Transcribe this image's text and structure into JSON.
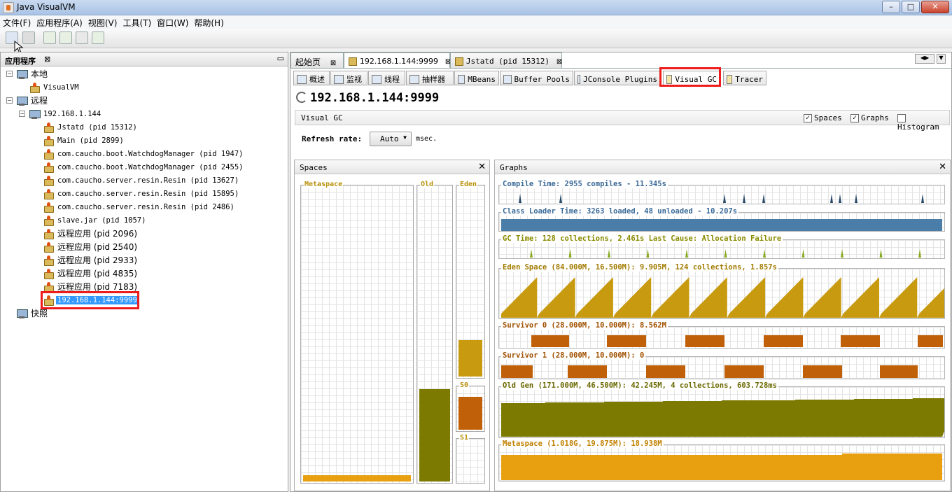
{
  "window": {
    "title": "Java VisualVM",
    "min": "–",
    "max": "□",
    "close": "✕"
  },
  "menu": [
    "文件(F)",
    "应用程序(A)",
    "视图(V)",
    "工具(T)",
    "窗口(W)",
    "帮助(H)"
  ],
  "left": {
    "title": "应用程序",
    "close": "⊠",
    "minimize": "▭",
    "tree": [
      {
        "label": "本地",
        "depth": 0,
        "icon": "computer-icon",
        "cn": true
      },
      {
        "label": "VisualVM",
        "depth": 1,
        "icon": "visualvm-icon"
      },
      {
        "label": "远程",
        "depth": 0,
        "icon": "remote-icon",
        "cn": true
      },
      {
        "label": "192.168.1.144",
        "depth": 1,
        "icon": "host-icon"
      },
      {
        "label": "Jstatd (pid 15312)",
        "depth": 2,
        "icon": "java-app-icon"
      },
      {
        "label": "Main (pid 2899)",
        "depth": 2,
        "icon": "java-app-icon"
      },
      {
        "label": "com.caucho.boot.WatchdogManager (pid 1947)",
        "depth": 2,
        "icon": "java-app-icon"
      },
      {
        "label": "com.caucho.boot.WatchdogManager (pid 2455)",
        "depth": 2,
        "icon": "java-app-icon"
      },
      {
        "label": "com.caucho.server.resin.Resin (pid 13627)",
        "depth": 2,
        "icon": "java-app-icon"
      },
      {
        "label": "com.caucho.server.resin.Resin (pid 15895)",
        "depth": 2,
        "icon": "java-app-icon"
      },
      {
        "label": "com.caucho.server.resin.Resin (pid 2486)",
        "depth": 2,
        "icon": "java-app-icon"
      },
      {
        "label": "slave.jar (pid 1057)",
        "depth": 2,
        "icon": "java-app-icon"
      },
      {
        "label": "远程应用 (pid 2096)",
        "depth": 2,
        "icon": "java-app-icon",
        "cn": true
      },
      {
        "label": "远程应用 (pid 2540)",
        "depth": 2,
        "icon": "java-app-icon",
        "cn": true
      },
      {
        "label": "远程应用 (pid 2933)",
        "depth": 2,
        "icon": "java-app-icon",
        "cn": true
      },
      {
        "label": "远程应用 (pid 4835)",
        "depth": 2,
        "icon": "java-app-icon",
        "cn": true
      },
      {
        "label": "远程应用 (pid 7183)",
        "depth": 2,
        "icon": "java-app-icon",
        "cn": true
      },
      {
        "label": "192.168.1.144:9999",
        "depth": 2,
        "icon": "jmx-icon",
        "selected": true
      },
      {
        "label": "快照",
        "depth": 0,
        "icon": "snapshot-icon",
        "cn": true
      }
    ]
  },
  "tabs": [
    {
      "label": "起始页",
      "close": "⊠"
    },
    {
      "label": "192.168.1.144:9999",
      "close": "⊠",
      "active": true
    },
    {
      "label": "Jstatd (pid 15312)",
      "close": "⊠"
    }
  ],
  "subtabs": [
    {
      "label": "概述"
    },
    {
      "label": "监视"
    },
    {
      "label": "线程"
    },
    {
      "label": "抽样器"
    },
    {
      "label": "MBeans"
    },
    {
      "label": "Buffer Pools"
    },
    {
      "label": "JConsole Plugins"
    },
    {
      "label": "Visual GC",
      "active": true
    },
    {
      "label": "Tracer"
    }
  ],
  "page": {
    "title": "192.168.1.144:9999",
    "section": "Visual GC",
    "refresh_label": "Refresh rate:",
    "refresh_value": "Auto",
    "refresh_unit": "msec.",
    "options": [
      {
        "label": "Spaces",
        "checked": true
      },
      {
        "label": "Graphs",
        "checked": true
      },
      {
        "label": "Histogram",
        "checked": false
      }
    ]
  },
  "spaces": {
    "title": "Spaces",
    "close": "✕",
    "metaspace": "Metaspace",
    "old": "Old",
    "eden": "Eden",
    "s0": "S0",
    "s1": "S1",
    "levels": {
      "metaspace": 0.02,
      "old": 0.31,
      "eden": 0.19,
      "s0": 0.74,
      "s1": 0.0
    }
  },
  "graphs": {
    "title": "Graphs",
    "close": "✕",
    "compile": "Compile Time: 2955 compiles - 11.345s",
    "classloader": "Class Loader Time: 3263 loaded, 48 unloaded - 10.207s",
    "gc": "GC Time: 128 collections, 2.461s  Last Cause: Allocation Failure",
    "eden": "Eden Space (84.000M, 16.500M): 9.905M, 124 collections, 1.857s",
    "s0": "Survivor 0 (28.000M, 10.000M): 8.562M",
    "s1": "Survivor 1 (28.000M, 10.000M): 0",
    "old": "Old Gen (171.000M, 46.500M): 42.245M, 4 collections, 603.728ms",
    "meta": "Metaspace (1.018G, 19.875M): 18.938M"
  },
  "colors": {
    "accent_red": "#ee1c1c",
    "eden": "#c89a10",
    "old": "#7c7a00",
    "survivor": "#c06008",
    "meta": "#e8a010",
    "class": "#4a7ea8",
    "gc": "#88aa20"
  }
}
